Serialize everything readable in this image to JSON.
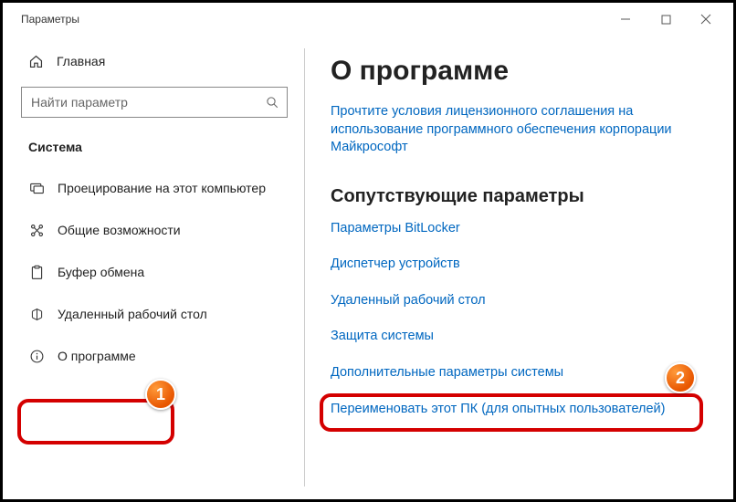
{
  "titlebar": {
    "title": "Параметры"
  },
  "sidebar": {
    "home": "Главная",
    "search_placeholder": "Найти параметр",
    "section": "Система",
    "items": [
      {
        "label": "Проецирование на этот компьютер"
      },
      {
        "label": "Общие возможности"
      },
      {
        "label": "Буфер обмена"
      },
      {
        "label": "Удаленный рабочий стол"
      },
      {
        "label": "О программе"
      }
    ]
  },
  "main": {
    "title": "О программе",
    "license_link": "Прочтите условия лицензионного соглашения на использование программного обеспечения корпорации Майкрософт",
    "related_title": "Сопутствующие параметры",
    "related": [
      "Параметры BitLocker",
      "Диспетчер устройств",
      "Удаленный рабочий стол",
      "Защита системы",
      "Дополнительные параметры системы",
      "Переименовать этот ПК (для опытных пользователей)"
    ]
  },
  "annotations": {
    "badge1": "1",
    "badge2": "2"
  }
}
